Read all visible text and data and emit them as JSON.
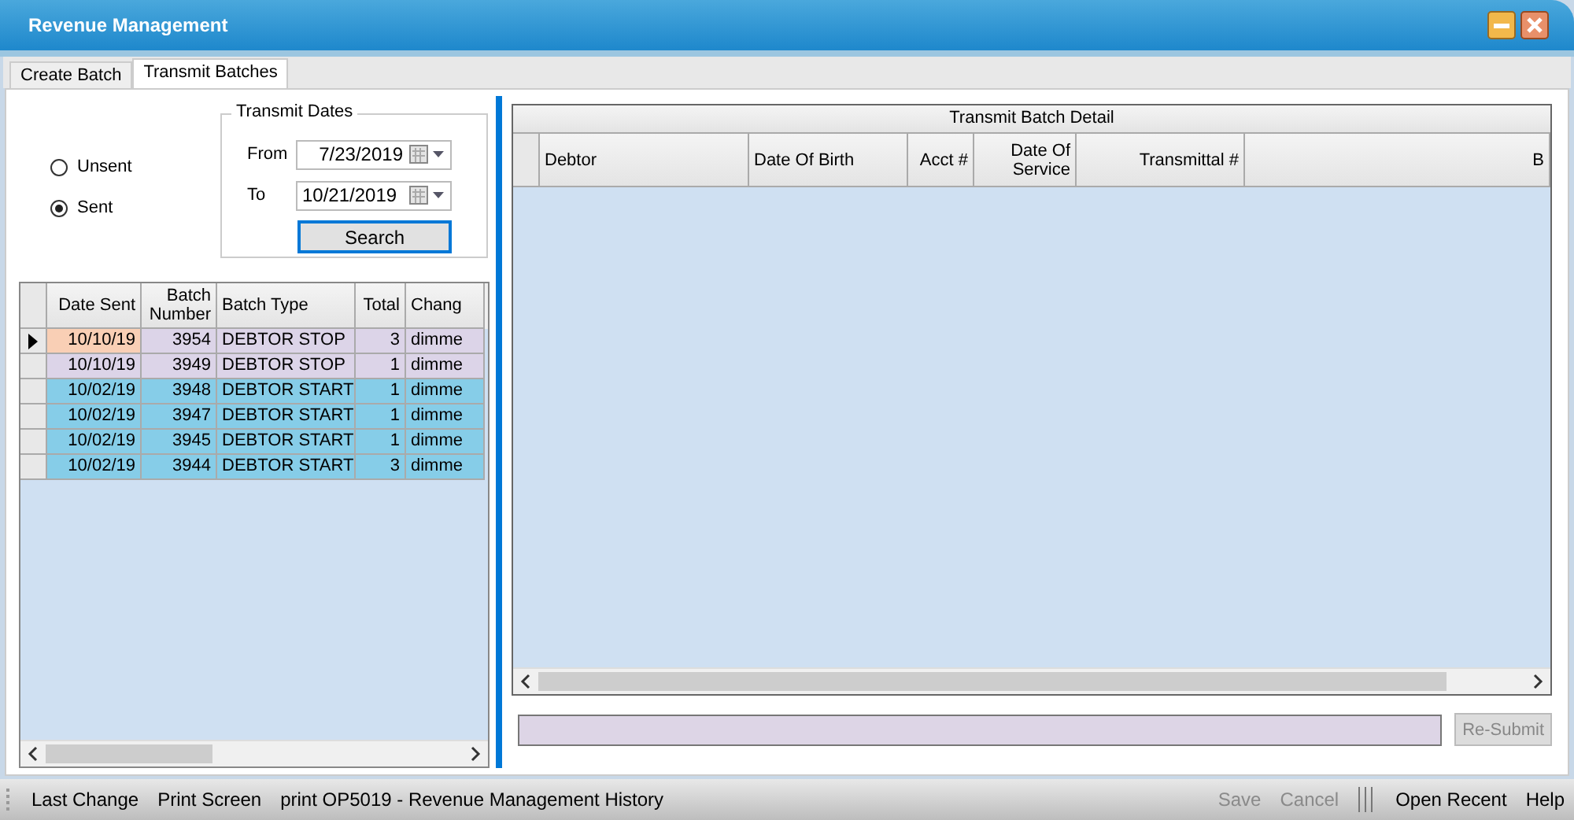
{
  "window": {
    "title": "Revenue Management"
  },
  "tabs": [
    {
      "label": "Create Batch",
      "selected": false
    },
    {
      "label": "Transmit Batches",
      "selected": true
    }
  ],
  "status_filter": [
    {
      "label": "Unsent",
      "selected": false
    },
    {
      "label": "Sent",
      "selected": true
    }
  ],
  "transmit_dates": {
    "title": "Transmit Dates",
    "from_label": "From",
    "from": "7/23/2019",
    "to_label": "To",
    "to": "10/21/2019",
    "search_button": "Search"
  },
  "batches": {
    "columns": [
      "Date Sent",
      "Batch Number",
      "Batch Type",
      "Total",
      "Chang"
    ],
    "rows": [
      {
        "current": true,
        "color": "#dcd4e8",
        "cells": [
          "10/10/19",
          "3954",
          "DEBTOR STOP",
          "3",
          "dimme"
        ]
      },
      {
        "current": false,
        "color": "#dcd4e8",
        "cells": [
          "10/10/19",
          "3949",
          "DEBTOR STOP",
          "1",
          "dimme"
        ]
      },
      {
        "current": false,
        "color": "#86cde8",
        "cells": [
          "10/02/19",
          "3948",
          "DEBTOR START",
          "1",
          "dimme"
        ]
      },
      {
        "current": false,
        "color": "#86cde8",
        "cells": [
          "10/02/19",
          "3947",
          "DEBTOR START",
          "1",
          "dimme"
        ]
      },
      {
        "current": false,
        "color": "#86cde8",
        "cells": [
          "10/02/19",
          "3945",
          "DEBTOR START",
          "1",
          "dimme"
        ]
      },
      {
        "current": false,
        "color": "#86cde8",
        "cells": [
          "10/02/19",
          "3944",
          "DEBTOR START",
          "3",
          "dimme"
        ]
      }
    ]
  },
  "detail": {
    "title": "Transmit Batch Detail",
    "columns": [
      "Debtor",
      "Date Of Birth",
      "Acct #",
      "Date Of Service",
      "Transmittal #",
      "B"
    ]
  },
  "resubmit_button": {
    "label": "Re-Submit",
    "disabled": true
  },
  "status_bar": {
    "left": [
      "Last Change",
      "Print Screen",
      "print OP5019 - Revenue Management History"
    ],
    "right": [
      {
        "label": "Save",
        "disabled": true
      },
      {
        "label": "Cancel",
        "disabled": true
      },
      {
        "label": "Open Recent",
        "disabled": false
      },
      {
        "label": "Help",
        "disabled": false
      }
    ]
  }
}
